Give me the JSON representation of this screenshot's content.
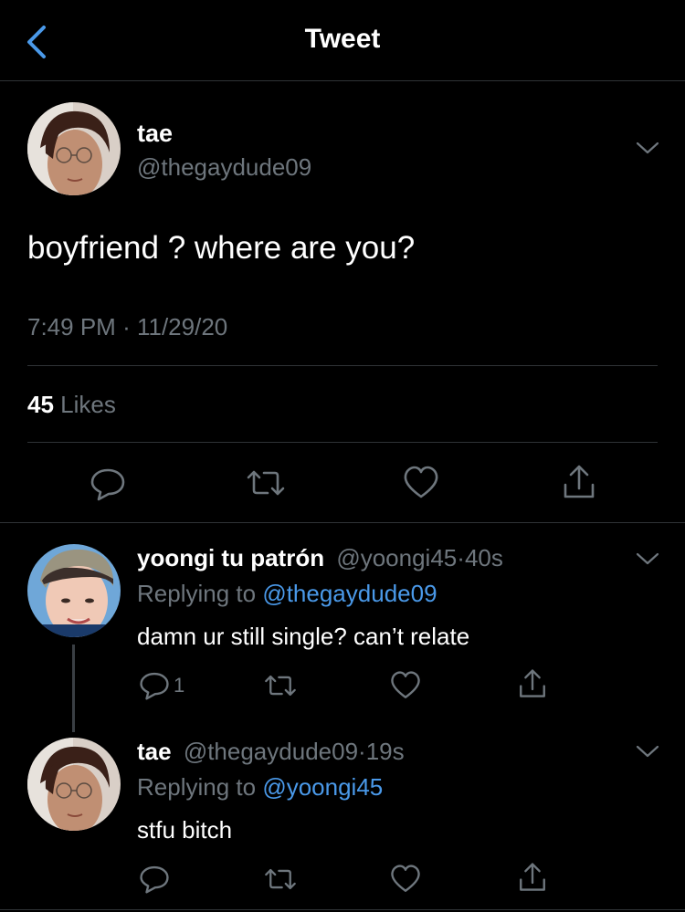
{
  "header": {
    "title": "Tweet"
  },
  "tweet": {
    "name": "tae",
    "handle": "@thegaydude09",
    "text": "boyfriend ? where are you?",
    "time": "7:49 PM",
    "separator": "·",
    "date": "11/29/20",
    "likes_count": "45",
    "likes_label": "Likes"
  },
  "replies": [
    {
      "name": "yoongi tu patrón",
      "handle": "@yoongi45",
      "time_sep": "·",
      "time": "40s",
      "replying_label": "Replying to",
      "replying_to": "@thegaydude09",
      "text": "damn ur still single? can’t relate",
      "reply_count": "1"
    },
    {
      "name": "tae",
      "handle": "@thegaydude09",
      "time_sep": "·",
      "time": "19s",
      "replying_label": "Replying to",
      "replying_to": "@yoongi45",
      "text": "stfu bitch",
      "reply_count": ""
    }
  ],
  "colors": {
    "accent": "#4a99e9",
    "muted": "#6e767d",
    "divider": "#2f3336",
    "background": "#000000"
  },
  "icons": [
    "back-chevron-icon",
    "chevron-down-icon",
    "reply-icon",
    "retweet-icon",
    "like-icon",
    "share-icon"
  ]
}
